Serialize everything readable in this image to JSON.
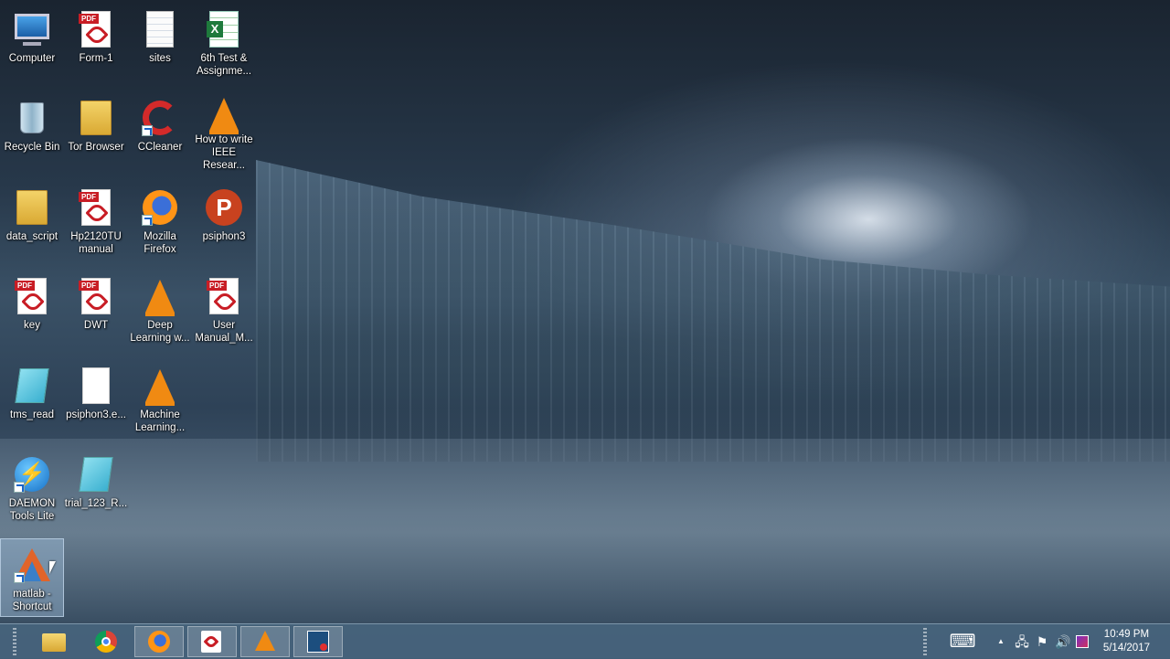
{
  "desktop": {
    "icons": [
      {
        "label": "Computer",
        "icon": "computer-icon"
      },
      {
        "label": "Form-1",
        "icon": "pdf-icon"
      },
      {
        "label": "sites",
        "icon": "text-document-icon"
      },
      {
        "label": "6th Test & Assignme...",
        "icon": "excel-icon"
      },
      {
        "label": "Recycle Bin",
        "icon": "recycle-bin-icon"
      },
      {
        "label": "Tor Browser",
        "icon": "folder-icon"
      },
      {
        "label": "CCleaner",
        "icon": "ccleaner-icon"
      },
      {
        "label": "How to write IEEE Resear...",
        "icon": "vlc-icon"
      },
      {
        "label": "data_script",
        "icon": "folder-icon"
      },
      {
        "label": "Hp2120TU manual",
        "icon": "pdf-icon"
      },
      {
        "label": "Mozilla Firefox",
        "icon": "firefox-icon"
      },
      {
        "label": "psiphon3",
        "icon": "psiphon-icon"
      },
      {
        "label": "key",
        "icon": "pdf-icon"
      },
      {
        "label": "DWT",
        "icon": "pdf-icon"
      },
      {
        "label": "Deep Learning w...",
        "icon": "vlc-icon"
      },
      {
        "label": "User Manual_M...",
        "icon": "pdf-icon"
      },
      {
        "label": "tms_read",
        "icon": "notepad-file-icon"
      },
      {
        "label": "psiphon3.e...",
        "icon": "blank-file-icon"
      },
      {
        "label": "Machine Learning...",
        "icon": "vlc-icon"
      },
      {
        "label": "DAEMON Tools Lite",
        "icon": "daemon-tools-icon"
      },
      {
        "label": "trial_123_R...",
        "icon": "notepad-file-icon"
      },
      {
        "label": "matlab - Shortcut",
        "icon": "matlab-icon"
      }
    ]
  },
  "pdf_tag": "PDF",
  "psiphon_glyph": "P",
  "excel_glyph": "X",
  "daemon_glyph": "⚡",
  "taskbar": {
    "pinned": [
      {
        "name": "file-explorer",
        "icon": "folder-icon"
      },
      {
        "name": "chrome",
        "icon": "chrome-icon"
      },
      {
        "name": "firefox",
        "icon": "firefox-icon"
      },
      {
        "name": "acrobat",
        "icon": "pdf-icon"
      },
      {
        "name": "vlc",
        "icon": "vlc-icon"
      },
      {
        "name": "screencast",
        "icon": "screen-recorder-icon"
      }
    ],
    "tray": {
      "keyboard_glyph": "⌨",
      "chevron_glyph": "▲",
      "network_glyph": "🖧",
      "flag_glyph": "⚑",
      "volume_glyph": "🔊"
    },
    "clock": {
      "time": "10:49 PM",
      "date": "5/14/2017"
    }
  }
}
